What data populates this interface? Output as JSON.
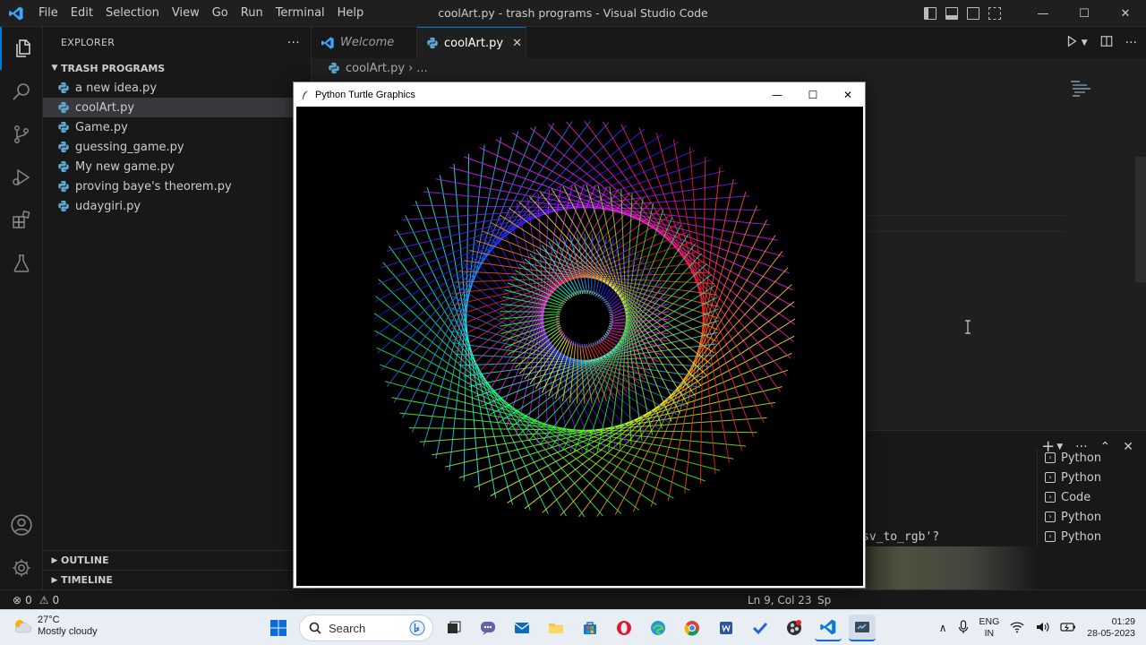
{
  "titlebar": {
    "menu": [
      "File",
      "Edit",
      "Selection",
      "View",
      "Go",
      "Run",
      "Terminal",
      "Help"
    ],
    "window_title": "coolArt.py - trash programs - Visual Studio Code",
    "controls": {
      "minimize": "—",
      "maximize": "☐",
      "close": "✕"
    }
  },
  "activity_bar": {
    "icons": [
      "files-icon",
      "search-icon",
      "source-control-icon",
      "run-debug-icon",
      "extensions-icon",
      "testing-icon"
    ],
    "bottom_icons": [
      "account-icon",
      "settings-gear-icon"
    ]
  },
  "sidebar": {
    "title": "EXPLORER",
    "more": "···",
    "folder": "TRASH PROGRAMS",
    "files": [
      {
        "name": "a new idea.py",
        "selected": false
      },
      {
        "name": "coolArt.py",
        "selected": true
      },
      {
        "name": "Game.py",
        "selected": false
      },
      {
        "name": "guessing_game.py",
        "selected": false
      },
      {
        "name": "My new game.py",
        "selected": false
      },
      {
        "name": "proving baye's theorem.py",
        "selected": false
      },
      {
        "name": "udaygiri.py",
        "selected": false
      }
    ],
    "outline": "OUTLINE",
    "timeline": "TIMELINE"
  },
  "editor": {
    "tabs": [
      {
        "label": "Welcome",
        "active": false
      },
      {
        "label": "coolArt.py",
        "active": true,
        "close": "✕"
      }
    ],
    "breadcrumb": {
      "file": "coolArt.py",
      "sep": "›",
      "rest": "..."
    }
  },
  "panel": {
    "terminals": [
      "Python",
      "Python",
      "Code",
      "Python",
      "Python"
    ],
    "terminal_text": "sv_to_rgb'?"
  },
  "statusbar": {
    "errors": "0",
    "warnings": "0",
    "position": "Ln 9, Col 23",
    "spaces": "Sp"
  },
  "turtle_window": {
    "title": "Python Turtle Graphics"
  },
  "taskbar": {
    "weather_temp": "27°C",
    "weather_desc": "Mostly cloudy",
    "search_label": "Search",
    "lang_top": "ENG",
    "lang_bottom": "IN",
    "time": "01:29",
    "date": "28-05-2023"
  },
  "colors": {
    "accent": "#0078d4",
    "editor_bg": "#1f1f1f",
    "sidebar_bg": "#181818",
    "taskbar_bg": "#e9eef5"
  }
}
